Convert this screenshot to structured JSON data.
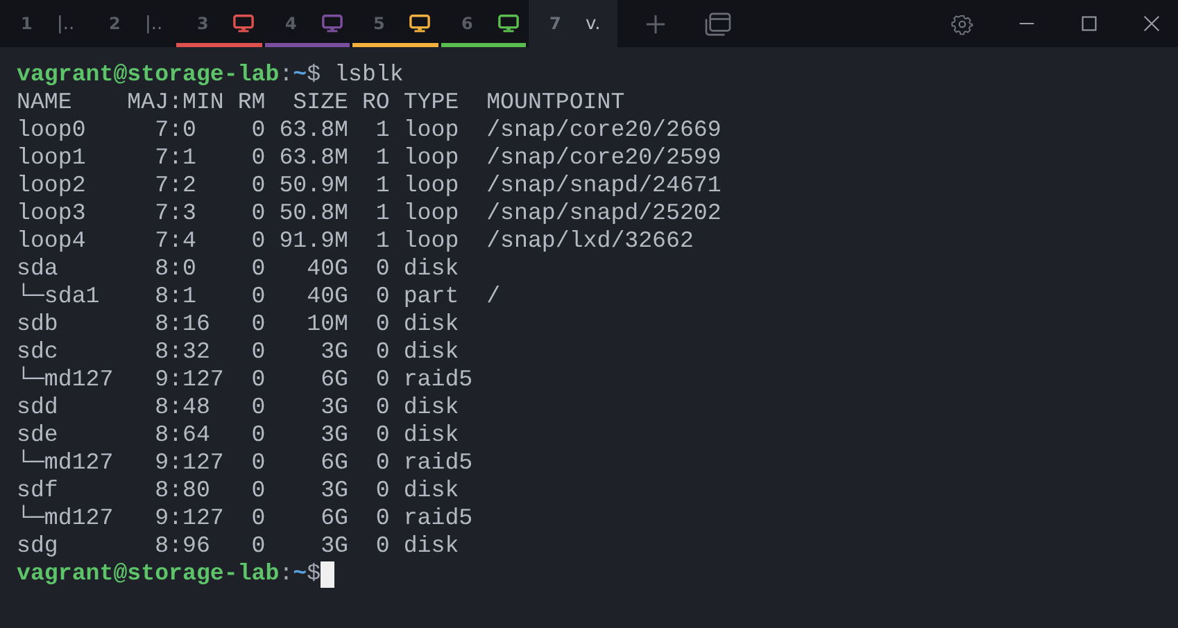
{
  "tabs": [
    {
      "number": "1",
      "kind": "text",
      "label": "|..",
      "selected": false
    },
    {
      "number": "2",
      "kind": "text",
      "label": "|..",
      "selected": false
    },
    {
      "number": "3",
      "kind": "icon",
      "color": "#e0524f",
      "selected": false
    },
    {
      "number": "4",
      "kind": "icon",
      "color": "#7b4f9e",
      "selected": false
    },
    {
      "number": "5",
      "kind": "icon",
      "color": "#f2b13f",
      "selected": false
    },
    {
      "number": "6",
      "kind": "icon",
      "color": "#5cbd4f",
      "selected": false
    },
    {
      "number": "7",
      "kind": "text",
      "label": "v.",
      "selected": true
    }
  ],
  "terminal": {
    "lines": [
      {
        "kind": "prompt",
        "user_host": "vagrant@storage-lab",
        "separator": ":",
        "path": "~",
        "symbol": "$",
        "command": "lsblk"
      },
      {
        "kind": "output",
        "text": "NAME    MAJ:MIN RM  SIZE RO TYPE  MOUNTPOINT"
      },
      {
        "kind": "output",
        "text": "loop0     7:0    0 63.8M  1 loop  /snap/core20/2669"
      },
      {
        "kind": "output",
        "text": "loop1     7:1    0 63.8M  1 loop  /snap/core20/2599"
      },
      {
        "kind": "output",
        "text": "loop2     7:2    0 50.9M  1 loop  /snap/snapd/24671"
      },
      {
        "kind": "output",
        "text": "loop3     7:3    0 50.8M  1 loop  /snap/snapd/25202"
      },
      {
        "kind": "output",
        "text": "loop4     7:4    0 91.9M  1 loop  /snap/lxd/32662"
      },
      {
        "kind": "output",
        "text": "sda       8:0    0   40G  0 disk"
      },
      {
        "kind": "output",
        "text": "└─sda1    8:1    0   40G  0 part  /"
      },
      {
        "kind": "output",
        "text": "sdb       8:16   0   10M  0 disk"
      },
      {
        "kind": "output",
        "text": "sdc       8:32   0    3G  0 disk"
      },
      {
        "kind": "output",
        "text": "└─md127   9:127  0    6G  0 raid5"
      },
      {
        "kind": "output",
        "text": "sdd       8:48   0    3G  0 disk"
      },
      {
        "kind": "output",
        "text": "sde       8:64   0    3G  0 disk"
      },
      {
        "kind": "output",
        "text": "└─md127   9:127  0    6G  0 raid5"
      },
      {
        "kind": "output",
        "text": "sdf       8:80   0    3G  0 disk"
      },
      {
        "kind": "output",
        "text": "└─md127   9:127  0    6G  0 raid5"
      },
      {
        "kind": "output",
        "text": "sdg       8:96   0    3G  0 disk"
      },
      {
        "kind": "prompt",
        "user_host": "vagrant@storage-lab",
        "separator": ":",
        "path": "~",
        "symbol": "$",
        "cursor": true
      }
    ]
  }
}
